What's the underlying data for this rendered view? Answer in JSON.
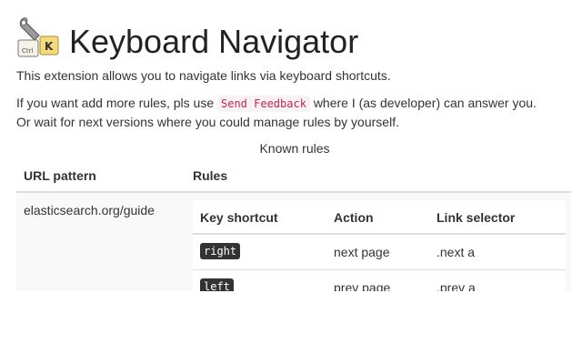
{
  "header": {
    "title": "Keyboard Navigator",
    "logo_icon": "wrench-keyboard-keys-icon",
    "logo_keys": [
      "Ctrl",
      "K"
    ]
  },
  "intro": {
    "text": "This extension allows you to navigate links via keyboard shortcuts."
  },
  "feedback": {
    "before": "If you want add more rules, pls use",
    "link": "Send Feedback",
    "after": "where I (as developer) can answer you.",
    "line2": "Or wait for next versions where you could manage rules by yourself."
  },
  "rules_table": {
    "caption": "Known rules",
    "headers": [
      "URL pattern",
      "Rules"
    ],
    "rows": [
      {
        "url": "elasticsearch.org/guide",
        "inner_headers": [
          "Key shortcut",
          "Action",
          "Link selector"
        ],
        "rules": [
          {
            "key": "right",
            "action": "next page",
            "selector": ".next a"
          },
          {
            "key": "left",
            "action": "prev page",
            "selector": ".prev a"
          }
        ]
      }
    ]
  },
  "colors": {
    "code_text": "#c7254e",
    "code_bg": "#f9f2f4",
    "kbd_bg": "#333333",
    "row_stripe": "#f9f9f9",
    "border": "#dddddd"
  }
}
